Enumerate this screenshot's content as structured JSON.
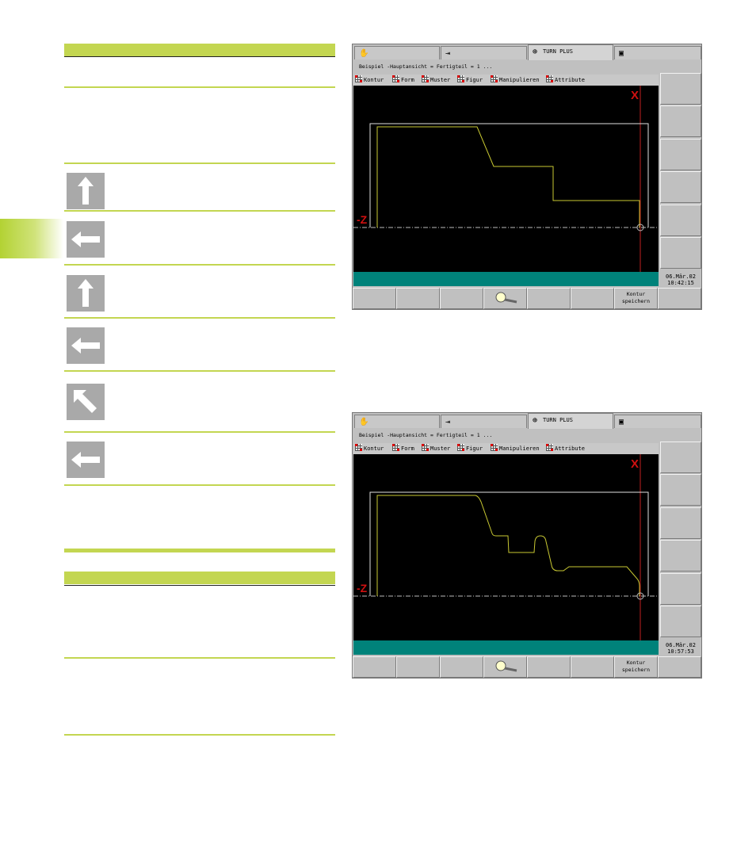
{
  "screens": [
    {
      "tabs": {
        "manual_icon": "hand-icon",
        "program_icon": "arrow-into-box-icon",
        "active_label": "TURN PLUS",
        "save_icon": "floppy-disk-icon"
      },
      "title": "Beispiel  -Hauptansicht = Fertigteil = 1 ...",
      "menu": [
        "Kontur",
        "Form",
        "Muster",
        "Figur",
        "Manipulieren",
        "Attribute"
      ],
      "axis_labels": {
        "x": "X",
        "z": "-Z"
      },
      "date": "06.Mär.02",
      "time": "10:42:15",
      "save_button_line1": "Kontur",
      "save_button_line2": "speichern"
    },
    {
      "tabs": {
        "manual_icon": "hand-icon",
        "program_icon": "arrow-into-box-icon",
        "active_label": "TURN PLUS",
        "save_icon": "floppy-disk-icon"
      },
      "title": "Beispiel  -Hauptansicht = Fertigteil = 1 ...",
      "menu": [
        "Kontur",
        "Form",
        "Muster",
        "Figur",
        "Manipulieren",
        "Attribute"
      ],
      "axis_labels": {
        "x": "X",
        "z": "-Z"
      },
      "date": "06.Mär.02",
      "time": "10:57:53",
      "save_button_line1": "Kontur",
      "save_button_line2": "speichern"
    }
  ],
  "left_column": {
    "arrow_icons": [
      "arrow-up-icon",
      "arrow-left-icon",
      "arrow-up-icon",
      "arrow-left-icon",
      "arrow-up-left-icon",
      "arrow-left-icon"
    ]
  },
  "colors": {
    "accent": "#c3d651",
    "status_bar": "#00827a",
    "contour": "#c8c832",
    "axis_marker": "#d01010"
  }
}
